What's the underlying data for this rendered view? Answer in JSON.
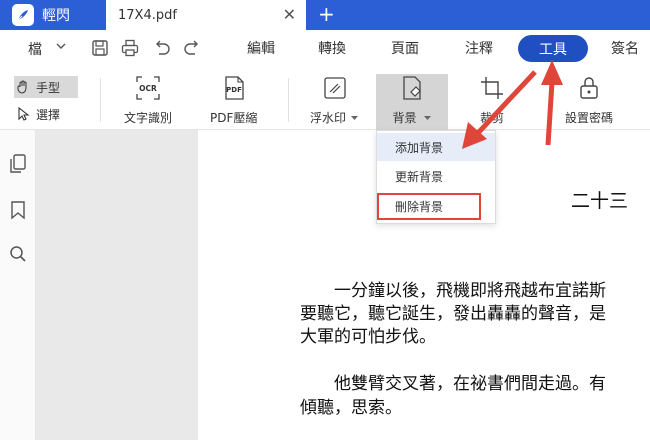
{
  "titlebar": {
    "app_name": "輕閃",
    "doc_tab": "17X4.pdf",
    "close_glyph": "✕",
    "new_tab_glyph": "+"
  },
  "menubar": {
    "file_label": "檔",
    "items": [
      "編輯",
      "轉換",
      "頁面",
      "注釋",
      "工具",
      "簽名"
    ],
    "active": "工具"
  },
  "toolbar": {
    "hand_label": "手型",
    "select_label": "選擇",
    "ocr_label": "文字識別",
    "ocr_icon_text": "OCR",
    "pdf_compress_label": "PDF壓縮",
    "pdf_icon_text": "PDF",
    "watermark_label": "浮水印",
    "background_label": "背景",
    "crop_label": "裁剪",
    "password_label": "設置密碼"
  },
  "dropdown": {
    "items": [
      "添加背景",
      "更新背景",
      "刪除背景"
    ]
  },
  "document": {
    "chapter_title": "二十三",
    "lines": [
      "　　一分鐘以後，飛機即將飛越布宜諾斯",
      "要聽它，聽它誕生，發出轟轟的聲音，是",
      "大軍的可怕步伐。",
      "　　他雙臂交叉著，在祕書們間走過。有",
      "傾聽，思索。"
    ]
  },
  "colors": {
    "brand_blue": "#2c5fd6",
    "active_menu": "#1f4fc0",
    "annotation_red": "#e0453a"
  },
  "icons": {
    "app_logo": "feather-icon",
    "save": "save-icon",
    "print": "print-icon",
    "undo": "undo-icon",
    "redo": "redo-icon",
    "thumbnails": "pages-icon",
    "bookmark": "bookmark-icon",
    "search": "search-icon"
  }
}
